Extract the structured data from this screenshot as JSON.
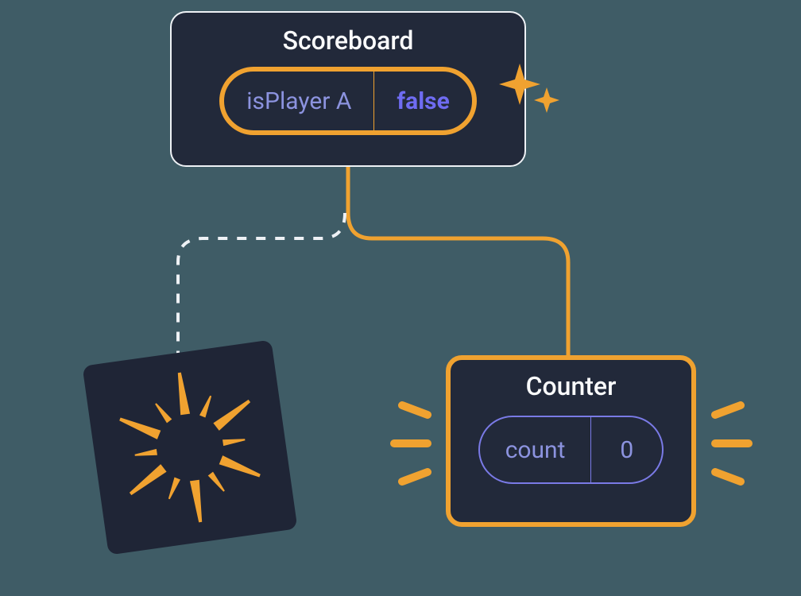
{
  "diagram": {
    "parent": {
      "title": "Scoreboard",
      "state_key": "isPlayer A",
      "state_value": "false",
      "highlighted": true
    },
    "child_mounted": {
      "title": "Counter",
      "state_key": "count",
      "state_value": "0",
      "highlighted": true
    },
    "child_unmounted": {
      "visual": "poof-burst"
    },
    "colors": {
      "card_bg": "#22293a",
      "accent": "#f0a230",
      "state_outline": "#7a7ae6",
      "state_text": "#8c93df",
      "value_text": "#6f6cf2",
      "canvas_bg": "#3f5c66"
    }
  }
}
